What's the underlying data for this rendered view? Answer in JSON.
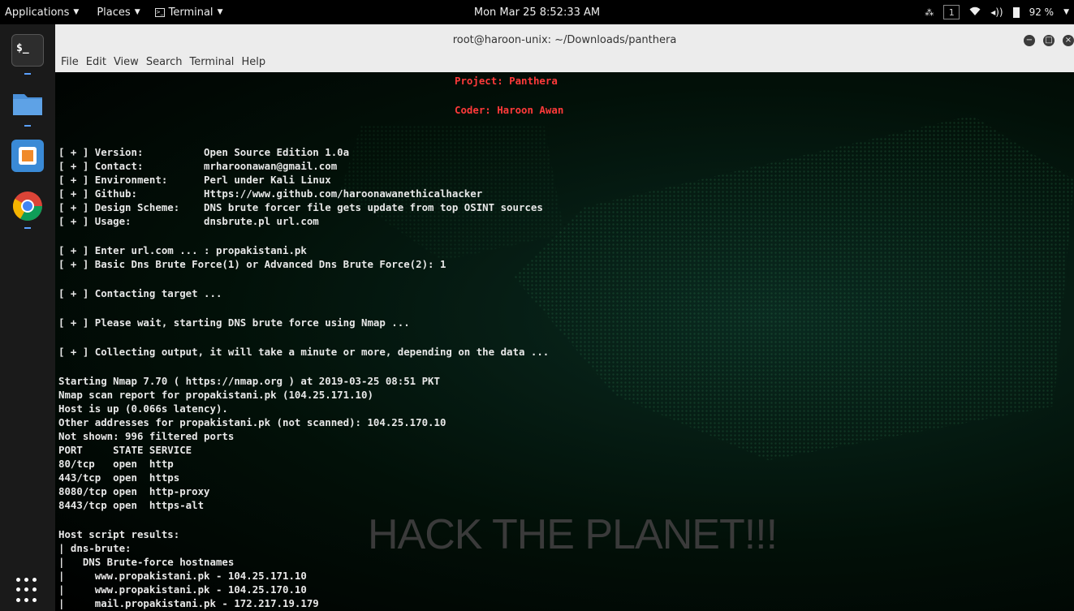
{
  "topbar": {
    "applications": "Applications",
    "places": "Places",
    "terminal": "Terminal",
    "clock": "Mon Mar 25  8:52:33 AM",
    "workspace": "1",
    "battery": "92 %"
  },
  "window": {
    "title": "root@haroon-unix: ~/Downloads/panthera",
    "menu": [
      "File",
      "Edit",
      "View",
      "Search",
      "Terminal",
      "Help"
    ]
  },
  "terminal": {
    "header": {
      "project": "Project: Panthera",
      "coder": "Coder: Haroon Awan"
    },
    "info": [
      "[ + ] Version:          Open Source Edition 1.0a",
      "[ + ] Contact:          mrharoonawan@gmail.com",
      "[ + ] Environment:      Perl under Kali Linux",
      "[ + ] Github:           Https://www.github.com/haroonawanethicalhacker",
      "[ + ] Design Scheme:    DNS brute forcer file gets update from top OSINT sources",
      "[ + ] Usage:            dnsbrute.pl url.com"
    ],
    "prompts": [
      "[ + ] Enter url.com ... : propakistani.pk",
      "[ + ] Basic Dns Brute Force(1) or Advanced Dns Brute Force(2): 1"
    ],
    "contacting": "[ + ] Contacting target ...",
    "waiting": "[ + ] Please wait, starting DNS brute force using Nmap ...",
    "collecting": "[ + ] Collecting output, it will take a minute or more, depending on the data ...",
    "nmap": [
      "Starting Nmap 7.70 ( https://nmap.org ) at 2019-03-25 08:51 PKT",
      "Nmap scan report for propakistani.pk (104.25.171.10)",
      "Host is up (0.066s latency).",
      "Other addresses for propakistani.pk (not scanned): 104.25.170.10",
      "Not shown: 996 filtered ports",
      "PORT     STATE SERVICE",
      "80/tcp   open  http",
      "443/tcp  open  https",
      "8080/tcp open  http-proxy",
      "8443/tcp open  https-alt"
    ],
    "script_results": [
      "Host script results:",
      "| dns-brute:",
      "|   DNS Brute-force hostnames",
      "|     www.propakistani.pk - 104.25.171.10",
      "|     www.propakistani.pk - 104.25.170.10",
      "|     mail.propakistani.pk - 172.217.19.179"
    ],
    "wallpaper_text": "HACK THE PLANET!!!"
  }
}
